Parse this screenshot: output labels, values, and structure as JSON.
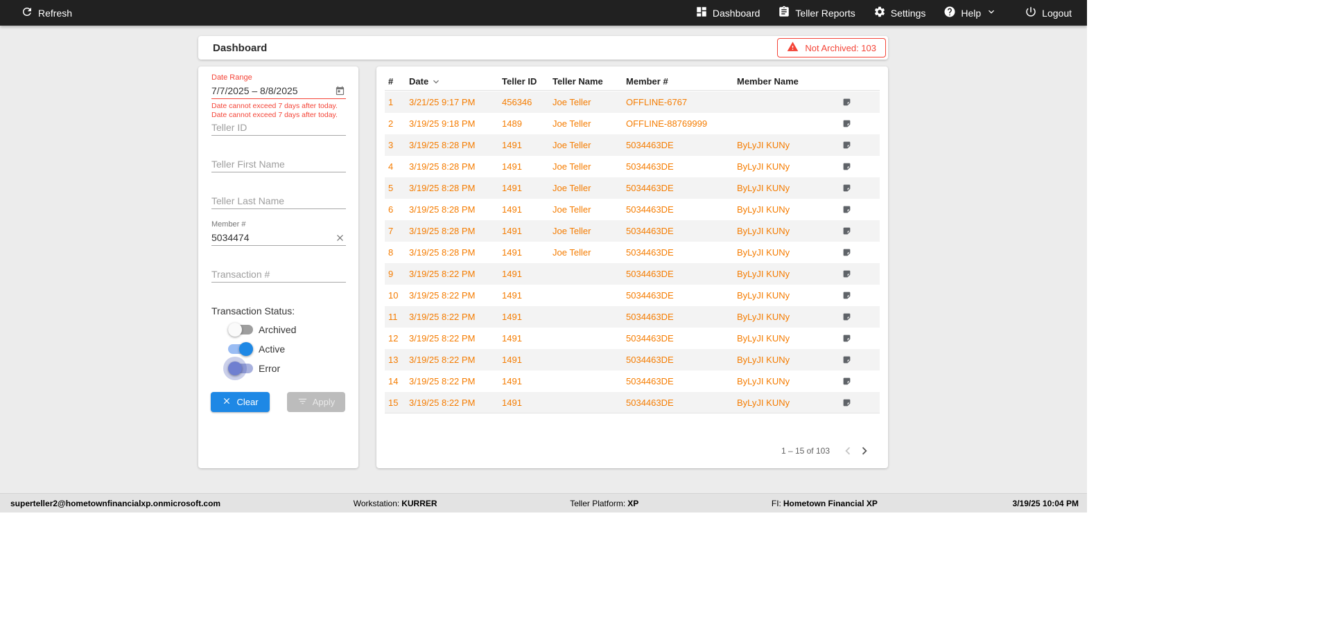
{
  "colors": {
    "topbar_bg": "#212121",
    "page_bg": "#ececec",
    "row_text_orange": "#f57c00",
    "error_red": "#f44336",
    "primary_blue": "#1e88e5"
  },
  "topbar": {
    "refresh_label": "Refresh",
    "nav": [
      {
        "label": "Dashboard",
        "icon": "dashboard-icon"
      },
      {
        "label": "Teller Reports",
        "icon": "reports-icon"
      },
      {
        "label": "Settings",
        "icon": "settings-icon"
      },
      {
        "label": "Help",
        "icon": "help-icon",
        "has_dropdown": true
      },
      {
        "label": "Logout",
        "icon": "logout-icon"
      }
    ]
  },
  "header": {
    "title": "Dashboard",
    "badge": {
      "label": "Not Archived: 103"
    }
  },
  "filters": {
    "date_range": {
      "label": "Date Range",
      "value": "7/7/2025 – 8/8/2025",
      "errors": [
        "Date cannot exceed 7 days after today.",
        "Date cannot exceed 7 days after today."
      ]
    },
    "teller_id_placeholder": "Teller ID",
    "teller_first_name_placeholder": "Teller First Name",
    "teller_last_name_placeholder": "Teller Last Name",
    "member": {
      "label": "Member #",
      "value": "5034474"
    },
    "transaction_placeholder": "Transaction #",
    "status": {
      "label": "Transaction Status:",
      "toggles": [
        {
          "label": "Archived",
          "checked": false,
          "focused": false
        },
        {
          "label": "Active",
          "checked": true,
          "focused": false
        },
        {
          "label": "Error",
          "checked": false,
          "focused": true
        }
      ]
    },
    "clear_label": "Clear",
    "apply_label": "Apply"
  },
  "table": {
    "columns": [
      "#",
      "Date",
      "Teller ID",
      "Teller Name",
      "Member #",
      "Member Name"
    ],
    "sort": {
      "column": "Date",
      "direction": "desc"
    },
    "rows": [
      {
        "num": "1",
        "date": "3/21/25 9:17 PM",
        "teller_id": "456346",
        "teller_name": "Joe Teller",
        "member_num": "OFFLINE-6767",
        "member_name": ""
      },
      {
        "num": "2",
        "date": "3/19/25 9:18 PM",
        "teller_id": "1489",
        "teller_name": "Joe Teller",
        "member_num": "OFFLINE-88769999",
        "member_name": ""
      },
      {
        "num": "3",
        "date": "3/19/25 8:28 PM",
        "teller_id": "1491",
        "teller_name": "Joe Teller",
        "member_num": "5034463DE",
        "member_name": "ByLyJI KUNy"
      },
      {
        "num": "4",
        "date": "3/19/25 8:28 PM",
        "teller_id": "1491",
        "teller_name": "Joe Teller",
        "member_num": "5034463DE",
        "member_name": "ByLyJI KUNy"
      },
      {
        "num": "5",
        "date": "3/19/25 8:28 PM",
        "teller_id": "1491",
        "teller_name": "Joe Teller",
        "member_num": "5034463DE",
        "member_name": "ByLyJI KUNy"
      },
      {
        "num": "6",
        "date": "3/19/25 8:28 PM",
        "teller_id": "1491",
        "teller_name": "Joe Teller",
        "member_num": "5034463DE",
        "member_name": "ByLyJI KUNy"
      },
      {
        "num": "7",
        "date": "3/19/25 8:28 PM",
        "teller_id": "1491",
        "teller_name": "Joe Teller",
        "member_num": "5034463DE",
        "member_name": "ByLyJI KUNy"
      },
      {
        "num": "8",
        "date": "3/19/25 8:28 PM",
        "teller_id": "1491",
        "teller_name": "Joe Teller",
        "member_num": "5034463DE",
        "member_name": "ByLyJI KUNy"
      },
      {
        "num": "9",
        "date": "3/19/25 8:22 PM",
        "teller_id": "1491",
        "teller_name": "",
        "member_num": "5034463DE",
        "member_name": "ByLyJI KUNy"
      },
      {
        "num": "10",
        "date": "3/19/25 8:22 PM",
        "teller_id": "1491",
        "teller_name": "",
        "member_num": "5034463DE",
        "member_name": "ByLyJI KUNy"
      },
      {
        "num": "11",
        "date": "3/19/25 8:22 PM",
        "teller_id": "1491",
        "teller_name": "",
        "member_num": "5034463DE",
        "member_name": "ByLyJI KUNy"
      },
      {
        "num": "12",
        "date": "3/19/25 8:22 PM",
        "teller_id": "1491",
        "teller_name": "",
        "member_num": "5034463DE",
        "member_name": "ByLyJI KUNy"
      },
      {
        "num": "13",
        "date": "3/19/25 8:22 PM",
        "teller_id": "1491",
        "teller_name": "",
        "member_num": "5034463DE",
        "member_name": "ByLyJI KUNy"
      },
      {
        "num": "14",
        "date": "3/19/25 8:22 PM",
        "teller_id": "1491",
        "teller_name": "",
        "member_num": "5034463DE",
        "member_name": "ByLyJI KUNy"
      },
      {
        "num": "15",
        "date": "3/19/25 8:22 PM",
        "teller_id": "1491",
        "teller_name": "",
        "member_num": "5034463DE",
        "member_name": "ByLyJI KUNy"
      }
    ],
    "pagination": {
      "range_label": "1 – 15 of 103"
    }
  },
  "statusbar": {
    "user": "superteller2@hometownfinancialxp.onmicrosoft.com",
    "workstation_label": "Workstation:",
    "workstation": "KURRER",
    "platform_label": "Teller Platform:",
    "platform": "XP",
    "fi_label": "FI:",
    "fi": "Hometown Financial XP",
    "datetime": "3/19/25 10:04 PM"
  }
}
